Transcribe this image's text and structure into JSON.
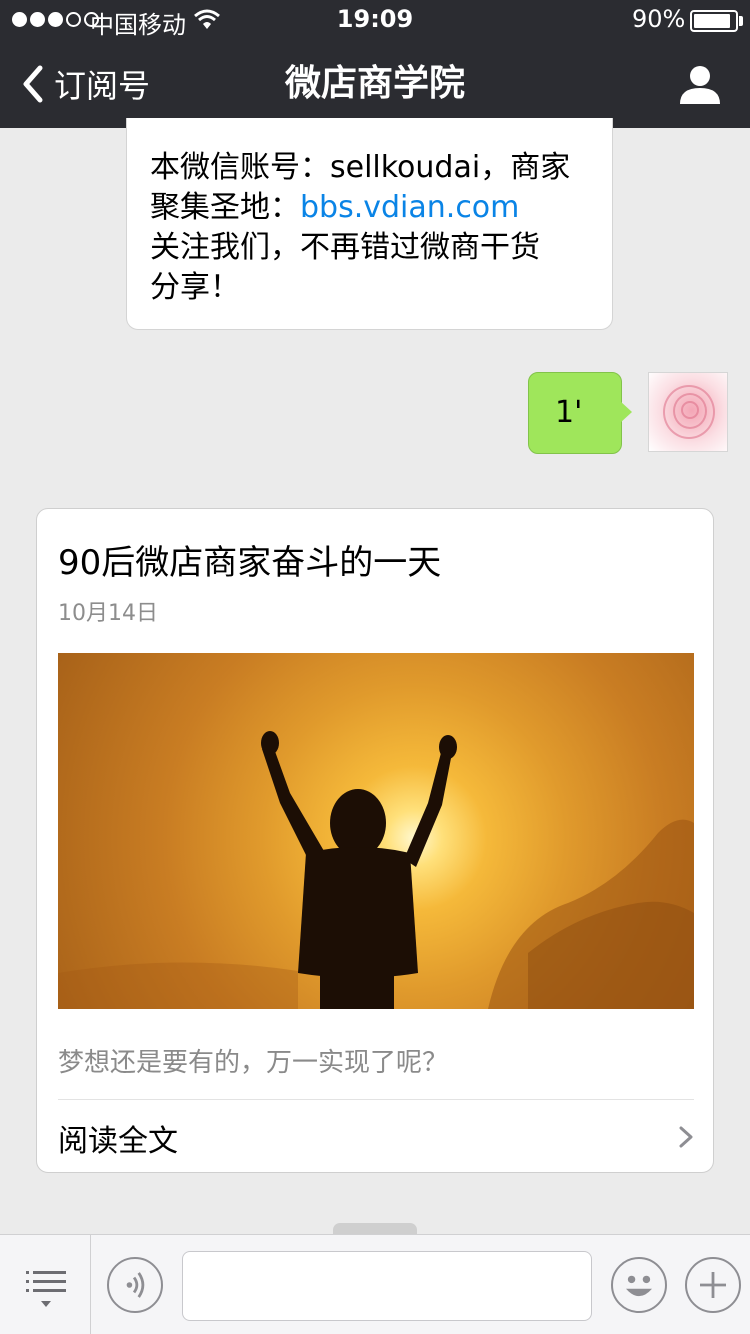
{
  "status_bar": {
    "carrier": "中国移动",
    "time": "19:09",
    "battery_percent": "90%",
    "battery_level": 0.9,
    "signal_strength": 3,
    "signal_max": 5
  },
  "nav": {
    "back_label": "订阅号",
    "title": "微店商学院",
    "back_icon": "chevron-left-icon",
    "profile_icon": "person-icon"
  },
  "messages": {
    "intro": {
      "line1": "本微信账号：sellkoudai，商家",
      "line2_prefix": "聚集圣地：",
      "link": "bbs.vdian.com",
      "line3": "关注我们，不再错过微商干货",
      "line4": "分享！"
    },
    "outgoing": {
      "text": "1'",
      "avatar_icon": "pink-rose-avatar"
    }
  },
  "article": {
    "title": "90后微店商家奋斗的一天",
    "date": "10月14日",
    "image_icon": "sunset-silhouette-image",
    "summary": "梦想还是要有的，万一实现了呢？",
    "read_more": "阅读全文"
  },
  "input_bar": {
    "menu_icon": "menu-list-icon",
    "voice_icon": "voice-icon",
    "emoji_icon": "emoji-icon",
    "plus_icon": "plus-icon",
    "text_value": ""
  },
  "colors": {
    "nav_bg": "#2b2c31",
    "chat_bg": "#ebebeb",
    "outgoing_bubble": "#9fe65b",
    "link": "#0a84e6"
  }
}
